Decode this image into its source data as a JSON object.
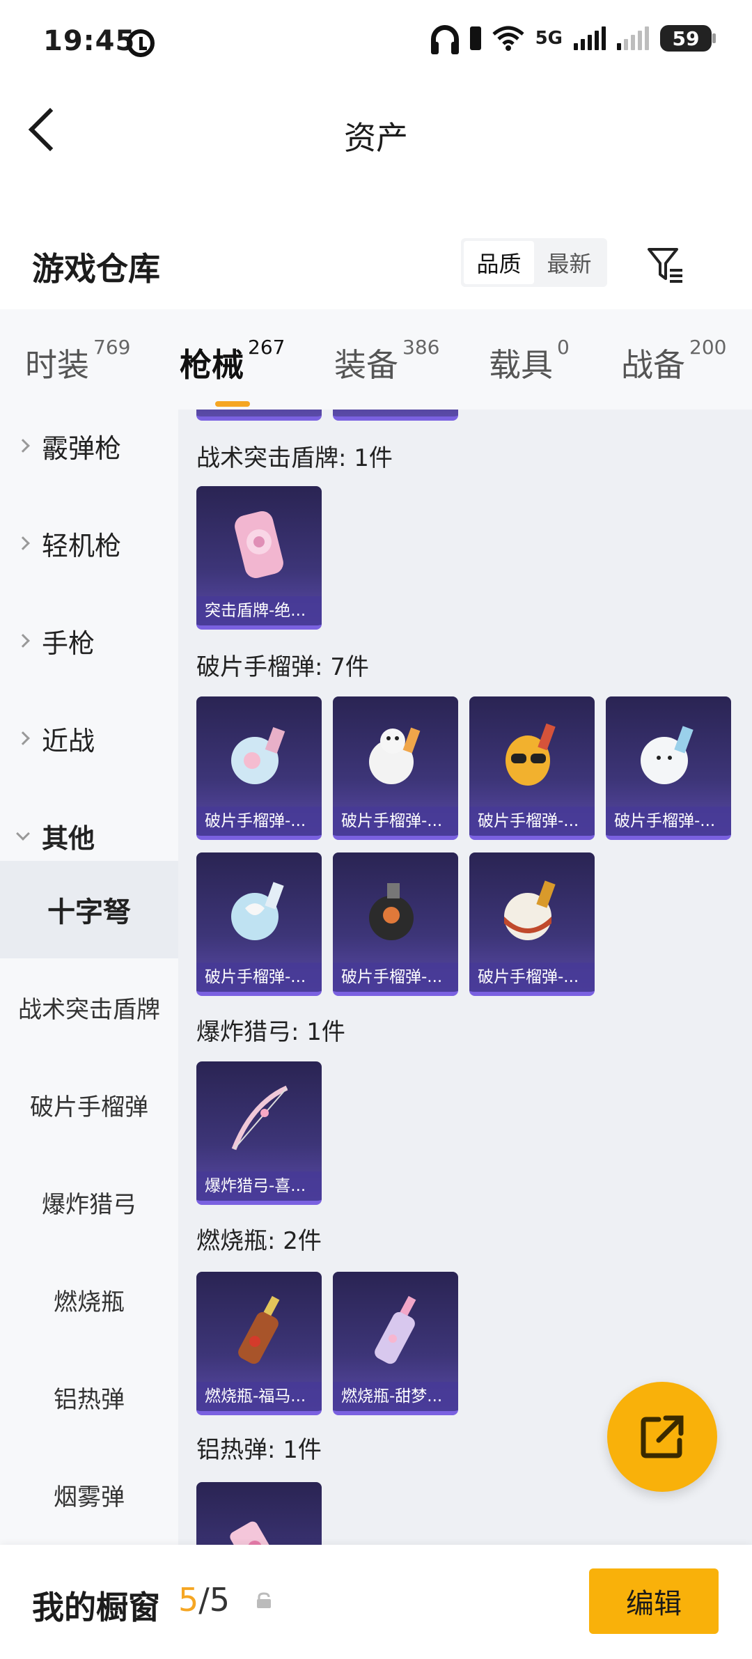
{
  "status": {
    "time": "19:45",
    "battery": "59",
    "network": "5G"
  },
  "header": {
    "title": "资产"
  },
  "section": {
    "title": "游戏仓库",
    "sort_options": [
      "品质",
      "最新"
    ],
    "sort_active": "品质"
  },
  "tabs": [
    {
      "label": "时装",
      "count": "769"
    },
    {
      "label": "枪械",
      "count": "267"
    },
    {
      "label": "装备",
      "count": "386"
    },
    {
      "label": "载具",
      "count": "0"
    },
    {
      "label": "战备",
      "count": "200"
    }
  ],
  "active_tab": "枪械",
  "sidebar": {
    "categories": [
      "霰弹枪",
      "轻机枪",
      "手枪",
      "近战",
      "其他"
    ],
    "selected": "十字弩",
    "subitems": [
      "战术突击盾牌",
      "破片手榴弹",
      "爆炸猎弓",
      "燃烧瓶",
      "铝热弹",
      "烟雾弹"
    ]
  },
  "groups": [
    {
      "label": "战术突击盾牌: 1件",
      "items": [
        "突击盾牌-绝..."
      ]
    },
    {
      "label": "破片手榴弹: 7件",
      "items": [
        "破片手榴弹-...",
        "破片手榴弹-...",
        "破片手榴弹-...",
        "破片手榴弹-...",
        "破片手榴弹-...",
        "破片手榴弹-...",
        "破片手榴弹-..."
      ]
    },
    {
      "label": "爆炸猎弓: 1件",
      "items": [
        "爆炸猎弓-喜..."
      ]
    },
    {
      "label": "燃烧瓶: 2件",
      "items": [
        "燃烧瓶-福马...",
        "燃烧瓶-甜梦..."
      ]
    },
    {
      "label": "铝热弹: 1件",
      "items": [
        ""
      ]
    }
  ],
  "bottom": {
    "title": "我的橱窗",
    "current": "5",
    "total": "/5",
    "edit_label": "编辑"
  },
  "colors": {
    "accent": "#f9b10a",
    "card_top": "#2a2453",
    "card_bottom": "#5a4aa8"
  }
}
